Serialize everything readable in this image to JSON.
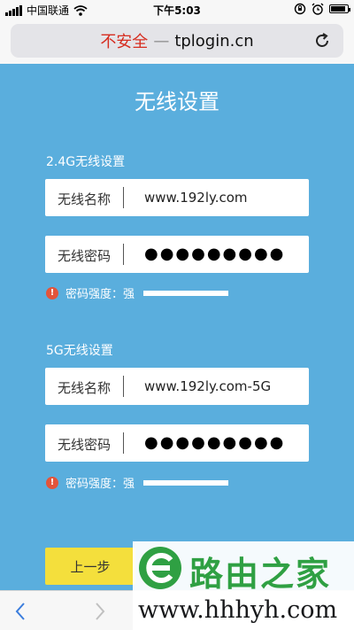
{
  "status_bar": {
    "carrier": "中国联通",
    "time": "下午5:03",
    "battery_level": 0.9
  },
  "address_bar": {
    "insecure_label": "不安全",
    "separator": "—",
    "host": "tplogin.cn",
    "reload_icon": "reload-icon"
  },
  "page": {
    "title": "无线设置",
    "band_24": {
      "section_title": "2.4G无线设置",
      "ssid_label": "无线名称",
      "ssid_value": "www.192ly.com",
      "password_label": "无线密码",
      "password_masked": "●●●●●●●●●",
      "strength_label": "密码强度：强",
      "strength_level": "强"
    },
    "band_5": {
      "section_title": "5G无线设置",
      "ssid_label": "无线名称",
      "ssid_value": "www.192ly.com-5G",
      "password_label": "无线密码",
      "password_masked": "●●●●●●●●●",
      "strength_label": "密码强度：强",
      "strength_level": "强"
    },
    "prev_button": "上一步"
  },
  "watermark": {
    "name": "路由之家",
    "url": "www.hhhyh.com"
  },
  "colors": {
    "page_background": "#5aaedd",
    "insecure_red": "#d62d20",
    "button_yellow": "#f4df3c",
    "warning_red": "#e3543a",
    "watermark_green": "#2fa043"
  }
}
